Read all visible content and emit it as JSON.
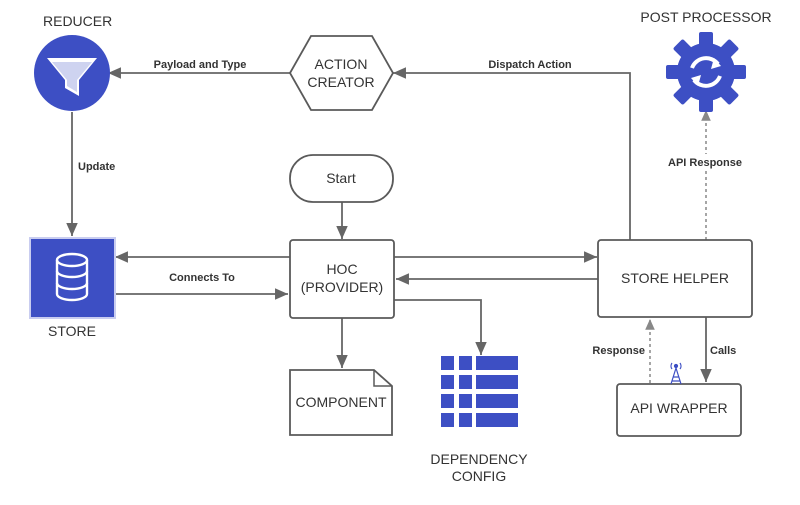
{
  "diagram": {
    "accent_color": "#3d4fc4",
    "nodes": {
      "reducer": {
        "label": "REDUCER",
        "icon": "filter-icon"
      },
      "action_creator": {
        "label_line1": "ACTION",
        "label_line2": "CREATOR"
      },
      "post_processor": {
        "label": "POST PROCESSOR",
        "icon": "gear-refresh-icon"
      },
      "start": {
        "label": "Start"
      },
      "store": {
        "label": "STORE",
        "icon": "database-icon"
      },
      "hoc": {
        "label_line1": "HOC",
        "label_line2": "(PROVIDER)"
      },
      "store_helper": {
        "label": "STORE HELPER"
      },
      "component": {
        "label": "COMPONENT"
      },
      "dependency_config": {
        "label_line1": "DEPENDENCY",
        "label_line2": "CONFIG",
        "icon": "table-icon"
      },
      "api_wrapper": {
        "label": "API WRAPPER",
        "icon": "antenna-icon"
      }
    },
    "edges": {
      "payload_and_type": "Payload and Type",
      "dispatch_action": "Dispatch Action",
      "update": "Update",
      "api_response": "API Response",
      "connects_to": "Connects To",
      "response": "Response",
      "calls": "Calls"
    }
  }
}
